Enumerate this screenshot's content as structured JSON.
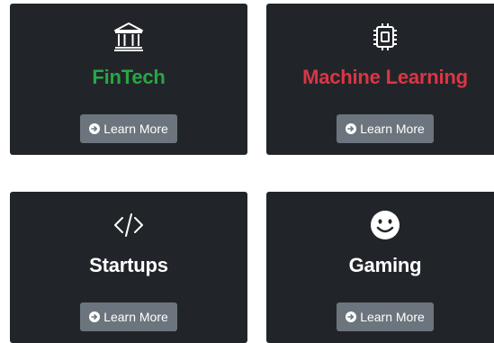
{
  "colors": {
    "card_bg": "#212529",
    "button_bg": "#6c757d",
    "fintech_title": "#28a745",
    "ml_title": "#dc3545",
    "default_title": "#ffffff"
  },
  "cards": [
    {
      "title": "FinTech",
      "title_color": "#28a745",
      "icon": "bank-icon",
      "button_label": "Learn More",
      "button_icon": "arrow-circle-right-icon"
    },
    {
      "title": "Machine Learning",
      "title_color": "#dc3545",
      "icon": "cpu-chip-icon",
      "button_label": "Learn More",
      "button_icon": "arrow-circle-right-icon"
    },
    {
      "title": "Startups",
      "title_color": "#ffffff",
      "icon": "code-icon",
      "button_label": "Learn More",
      "button_icon": "arrow-circle-right-icon"
    },
    {
      "title": "Gaming",
      "title_color": "#ffffff",
      "icon": "smile-icon",
      "button_label": "Learn More",
      "button_icon": "arrow-circle-right-icon"
    }
  ]
}
